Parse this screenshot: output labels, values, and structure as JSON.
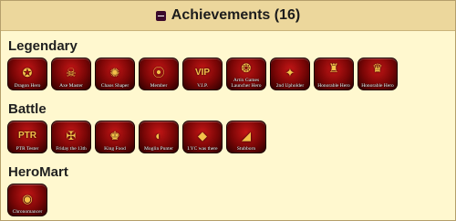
{
  "header": {
    "title": "Achievements (16)",
    "toggle_icon": "minus-square-icon"
  },
  "sections": [
    {
      "title": "Legendary",
      "badges": [
        {
          "label": "Dragon Hero",
          "emblem": "✪",
          "icon": "dragon-hero-icon"
        },
        {
          "label": "Axe Master",
          "emblem": "☠",
          "icon": "axe-master-icon"
        },
        {
          "label": "Chaos Shaper",
          "emblem": "✺",
          "icon": "chaos-shaper-icon"
        },
        {
          "label": "Member",
          "emblem": "⦿",
          "icon": "member-icon"
        },
        {
          "label": "V.I.P.",
          "emblem": "VIP",
          "icon": "vip-icon"
        },
        {
          "label": "Artix Games Launcher Hero",
          "emblem": "❂",
          "icon": "artix-games-launcher-hero-icon"
        },
        {
          "label": "2nd Upholder",
          "emblem": "✦",
          "icon": "second-upholder-icon"
        },
        {
          "label": "Honorable Hero",
          "emblem": "♜",
          "icon": "honorable-hero-icon"
        },
        {
          "label": "Honorable Hero",
          "emblem": "♛",
          "icon": "honorable-hero-alt-icon"
        }
      ]
    },
    {
      "title": "Battle",
      "badges": [
        {
          "label": "PTR Tester",
          "emblem": "PTR",
          "icon": "ptr-tester-icon"
        },
        {
          "label": "Friday the 13th",
          "emblem": "✠",
          "icon": "friday-the-13th-icon"
        },
        {
          "label": "King Food",
          "emblem": "♚",
          "icon": "king-food-icon"
        },
        {
          "label": "Moglin Punter",
          "emblem": "◐",
          "icon": "moglin-punter-icon"
        },
        {
          "label": "I.YC was there",
          "emblem": "◆",
          "icon": "iyc-was-there-icon"
        },
        {
          "label": "Stubborn",
          "emblem": "◢",
          "icon": "stubborn-icon"
        }
      ]
    },
    {
      "title": "HeroMart",
      "badges": [
        {
          "label": "Chronomancer",
          "emblem": "◉",
          "icon": "chronomancer-icon"
        }
      ]
    }
  ],
  "colors": {
    "panel_background": "#fff8cf",
    "header_background": "#ecd79c",
    "badge_red": "#c41616",
    "badge_gold": "#f3c14a"
  }
}
